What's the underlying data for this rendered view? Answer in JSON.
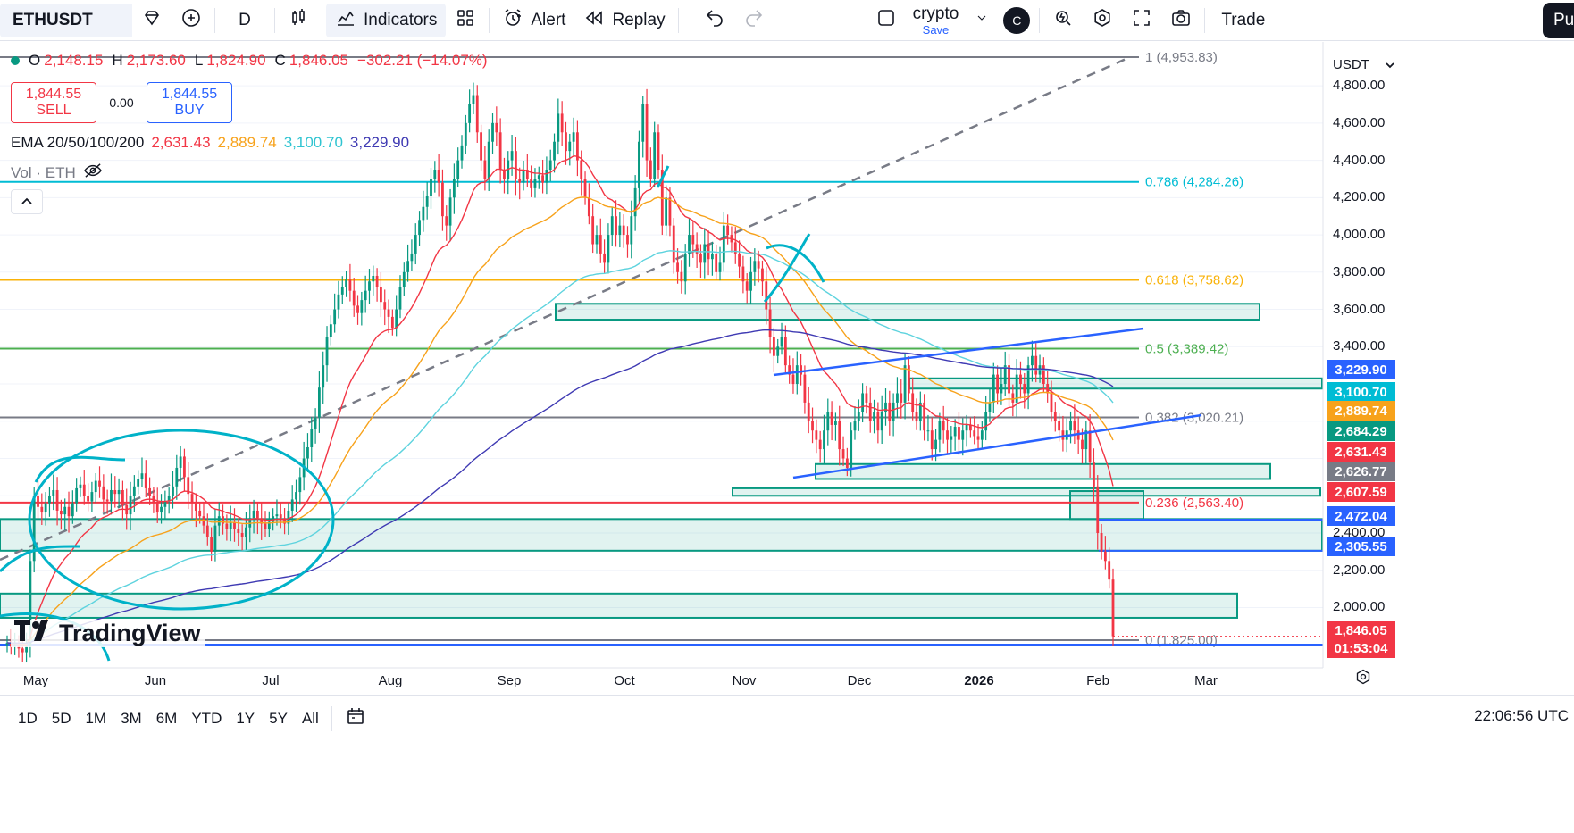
{
  "toolbar": {
    "symbol": "ETHUSDT",
    "interval": "D",
    "indicators_label": "Indicators",
    "alert_label": "Alert",
    "replay_label": "Replay",
    "layout_name": "crypto",
    "layout_save": "Save",
    "avatar_letter": "C",
    "trade_label": "Trade",
    "publish_label": "Pu"
  },
  "legend": {
    "o_label": "O",
    "o": "2,148.15",
    "h_label": "H",
    "h": "2,173.60",
    "l_label": "L",
    "l": "1,824.90",
    "c_label": "C",
    "c": "1,846.05",
    "change": "−302.21 (−14.07%)",
    "sell_price": "1,844.55",
    "sell_label": "SELL",
    "spread": "0.00",
    "buy_price": "1,844.55",
    "buy_label": "BUY",
    "ema_label": "EMA 20/50/100/200",
    "ema20": "2,631.43",
    "ema50": "2,889.74",
    "ema100": "3,100.70",
    "ema200": "3,229.90",
    "vol_label": "Vol · ETH"
  },
  "colors": {
    "up": "#089981",
    "down": "#f23645",
    "ema20": "#f23645",
    "ema50": "#f7a21b",
    "ema100": "#5ed3de",
    "ema200": "#3f3ab3",
    "fib_1": "#787b86",
    "fib_0786": "#00bcd4",
    "fib_0618": "#f9b208",
    "fib_05": "#4caf50",
    "fib_0382": "#787b86",
    "fib_0236": "#f23645",
    "fib_0": "#787b86",
    "trend": "#2962ff",
    "zone_fill": "rgba(8,153,129,0.12)",
    "zone_border": "#089981",
    "circle": "#00b2c8"
  },
  "price_scale": {
    "currency": "USDT",
    "ticks": [
      "4,800.00",
      "4,600.00",
      "4,400.00",
      "4,200.00",
      "4,000.00",
      "3,800.00",
      "3,600.00",
      "3,400.00",
      "2,400.00",
      "2,200.00",
      "2,000.00"
    ],
    "labels": [
      {
        "value": "3,229.90",
        "color": "#2962ff"
      },
      {
        "value": "3,100.70",
        "color": "#00bcd4"
      },
      {
        "value": "2,889.74",
        "color": "#f7a21b"
      },
      {
        "value": "2,684.29",
        "color": "#089981"
      },
      {
        "value": "2,631.43",
        "color": "#f23645"
      },
      {
        "value": "2,626.77",
        "color": "#787b86"
      },
      {
        "value": "2,607.59",
        "color": "#f23645"
      },
      {
        "value": "2,472.04",
        "color": "#2962ff"
      },
      {
        "value": "2,305.55",
        "color": "#2962ff"
      },
      {
        "value": "1,846.05",
        "color": "#f23645"
      },
      {
        "value": "01:53:04",
        "color": "#f23645"
      }
    ]
  },
  "fib": [
    {
      "level": "1 (4,953.83)",
      "value": 4953.83,
      "key": "fib_1"
    },
    {
      "level": "0.786 (4,284.26)",
      "value": 4284.26,
      "key": "fib_0786"
    },
    {
      "level": "0.618 (3,758.62)",
      "value": 3758.62,
      "key": "fib_0618"
    },
    {
      "level": "0.5 (3,389.42)",
      "value": 3389.42,
      "key": "fib_05"
    },
    {
      "level": "0.382 (3,020.21)",
      "value": 3020.21,
      "key": "fib_0382"
    },
    {
      "level": "0.236 (2,563.40)",
      "value": 2563.4,
      "key": "fib_0236"
    },
    {
      "level": "0 (1,825.00)",
      "value": 1825.0,
      "key": "fib_0"
    }
  ],
  "date_axis": [
    {
      "label": "May",
      "year": false
    },
    {
      "label": "Jun",
      "year": false
    },
    {
      "label": "Jul",
      "year": false
    },
    {
      "label": "Aug",
      "year": false
    },
    {
      "label": "Sep",
      "year": false
    },
    {
      "label": "Oct",
      "year": false
    },
    {
      "label": "Nov",
      "year": false
    },
    {
      "label": "Dec",
      "year": false
    },
    {
      "label": "2026",
      "year": true
    },
    {
      "label": "Feb",
      "year": false
    },
    {
      "label": "Mar",
      "year": false
    }
  ],
  "ranges": [
    "1D",
    "5D",
    "1M",
    "3M",
    "6M",
    "YTD",
    "1Y",
    "5Y",
    "All"
  ],
  "clock": "22:06:56 UTC",
  "branding": "TradingView",
  "chart_data": {
    "type": "candlestick",
    "series_close": [
      1810,
      1790,
      1800,
      1780,
      1760,
      1790,
      2250,
      2600,
      2540,
      2510,
      2560,
      2600,
      2630,
      2520,
      2500,
      2540,
      2490,
      2560,
      2640,
      2660,
      2600,
      2570,
      2620,
      2680,
      2650,
      2580,
      2570,
      2630,
      2610,
      2630,
      2550,
      2500,
      2600,
      2650,
      2690,
      2720,
      2640,
      2600,
      2560,
      2510,
      2540,
      2570,
      2600,
      2650,
      2750,
      2810,
      2700,
      2610,
      2560,
      2520,
      2490,
      2440,
      2380,
      2300,
      2440,
      2490,
      2450,
      2420,
      2460,
      2420,
      2400,
      2380,
      2430,
      2480,
      2520,
      2480,
      2450,
      2420,
      2460,
      2490,
      2500,
      2480,
      2450,
      2520,
      2580,
      2620,
      2700,
      2800,
      2860,
      2960,
      3020,
      3180,
      3300,
      3450,
      3520,
      3600,
      3680,
      3720,
      3760,
      3700,
      3620,
      3580,
      3650,
      3700,
      3750,
      3780,
      3720,
      3640,
      3600,
      3560,
      3500,
      3600,
      3720,
      3800,
      3860,
      3900,
      4000,
      4080,
      4150,
      4210,
      4300,
      4350,
      4280,
      4100,
      4050,
      4200,
      4300,
      4400,
      4480,
      4600,
      4700,
      4750,
      4550,
      4400,
      4300,
      4500,
      4600,
      4550,
      4350,
      4300,
      4400,
      4450,
      4300,
      4280,
      4350,
      4300,
      4250,
      4300,
      4320,
      4280,
      4350,
      4400,
      4500,
      4650,
      4550,
      4450,
      4500,
      4550,
      4400,
      4300,
      4200,
      4100,
      3950,
      4000,
      3900,
      3850,
      4000,
      4100,
      4000,
      4050,
      4000,
      3950,
      4100,
      4250,
      4500,
      4700,
      4400,
      4300,
      4550,
      4350,
      4050,
      4200,
      4050,
      3850,
      3800,
      3750,
      3900,
      4000,
      3950,
      3900,
      3850,
      3950,
      3870,
      3900,
      3800,
      3850,
      4050,
      4000,
      3960,
      3900,
      3830,
      3750,
      3700,
      3800,
      3860,
      3820,
      3750,
      3600,
      3450,
      3350,
      3400,
      3450,
      3300,
      3250,
      3200,
      3300,
      3250,
      3100,
      3000,
      2950,
      2900,
      2850,
      2950,
      3050,
      2980,
      3000,
      2850,
      2800,
      2750,
      2950,
      3000,
      3050,
      3150,
      3100,
      3000,
      3050,
      2950,
      3050,
      3100,
      3000,
      3100,
      3150,
      3100,
      3300,
      3150,
      3050,
      3000,
      3100,
      2950,
      2950,
      2850,
      2900,
      3000,
      2950,
      2900,
      2920,
      2970,
      2900,
      2950,
      2980,
      2950,
      2920,
      2900,
      2950,
      3050,
      3100,
      3250,
      3150,
      3200,
      3300,
      3150,
      3100,
      3250,
      3200,
      3150,
      3300,
      3350,
      3250,
      3300,
      3200,
      3150,
      3050,
      3000,
      2950,
      2900,
      2950,
      3000,
      2950,
      2900,
      2850,
      2950,
      2780,
      2650,
      2400,
      2300,
      2250,
      2150,
      1846
    ]
  }
}
